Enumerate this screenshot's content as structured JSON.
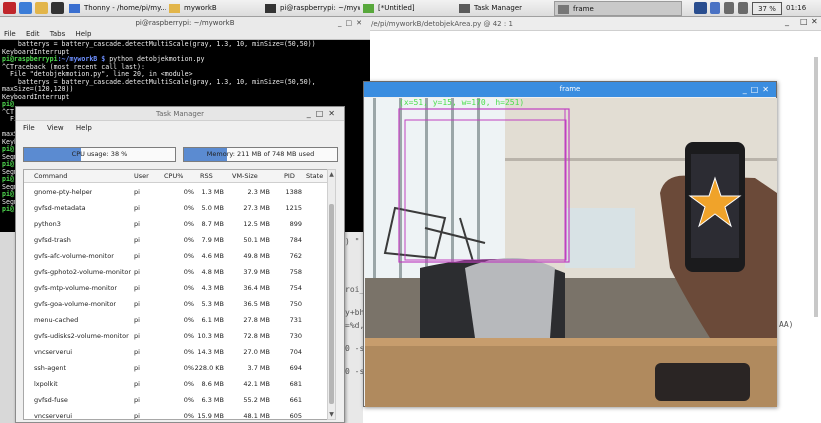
{
  "panel": {
    "tasks": [
      {
        "label": "Thonny - /home/pi/my..."
      },
      {
        "label": "myworkB"
      },
      {
        "label": "pi@raspberrypi: ~/mywo..."
      },
      {
        "label": "[*Untitled]"
      },
      {
        "label": "Task Manager"
      },
      {
        "label": "frame"
      }
    ],
    "battery": "37 %",
    "clock": "01:16"
  },
  "terminal": {
    "title": "pi@raspberrypi: ~/myworkB",
    "menu": [
      "File",
      "Edit",
      "Tabs",
      "Help"
    ],
    "lines": [
      {
        "t": "    batterys = battery_cascade.detectMultiScale(gray, 1.3, 10, minSize=(50,50))",
        "c": ""
      },
      {
        "t": "KeyboardInterrupt",
        "c": ""
      },
      {
        "p": "pi@raspberrypi",
        "d": ":~/myworkB $",
        "t": " python detobjekmotion.py"
      },
      {
        "t": "^CTraceback (most recent call last):",
        "c": ""
      },
      {
        "t": "  File \"detobjekmotion.py\", line 20, in <module>",
        "c": ""
      },
      {
        "t": "    batterys = battery_cascade.detectMultiScale(gray, 1.3, 10, minSize=(50,50),",
        "c": ""
      },
      {
        "t": "maxSize=(120,120))",
        "c": ""
      },
      {
        "t": "KeyboardInterrupt",
        "c": ""
      },
      {
        "p": "pi@",
        "d": "",
        "t": ""
      },
      {
        "t": "^CTr",
        "c": ""
      },
      {
        "t": "  Fi",
        "c": ""
      },
      {
        "t": "                                                                       0),",
        "c": ""
      },
      {
        "t": "maxS",
        "c": ""
      },
      {
        "t": "Keyb",
        "c": ""
      },
      {
        "p": "pi@",
        "d": "",
        "t": ""
      },
      {
        "t": "Segm",
        "c": ""
      },
      {
        "p": "pi@",
        "d": "",
        "t": ""
      },
      {
        "t": "Segm",
        "c": ""
      },
      {
        "p": "pi@",
        "d": "",
        "t": ""
      },
      {
        "t": "Segm",
        "c": ""
      },
      {
        "p": "pi@",
        "d": "",
        "t": ""
      },
      {
        "t": "Segm",
        "c": ""
      },
      {
        "p": "pi@",
        "d": "",
        "t": ""
      }
    ]
  },
  "editor": {
    "tab": "/e/pi/myworkB/detobjekArea.py  @  42 : 1",
    "fragments": [
      ") \" %",
      "roi_",
      "y+bh",
      "=%d,",
      "0 -s",
      "0 -s",
      "AA)"
    ]
  },
  "taskmanager": {
    "title": "Task Manager",
    "menu": [
      "File",
      "View",
      "Help"
    ],
    "cpu_label": "CPU usage: 38 %",
    "cpu_fraction": 0.38,
    "mem_label": "Memory: 211 MB of 748 MB used",
    "mem_fraction": 0.282,
    "columns": [
      "Command",
      "User",
      "CPU%",
      "RSS",
      "VM-Size",
      "PID",
      "State"
    ],
    "rows": [
      [
        "gnome-pty-helper",
        "pi",
        "0%",
        "1.3 MB",
        "2.3 MB",
        "1388"
      ],
      [
        "gvfsd-metadata",
        "pi",
        "0%",
        "5.0 MB",
        "27.3 MB",
        "1215"
      ],
      [
        "python3",
        "pi",
        "0%",
        "8.7 MB",
        "12.5 MB",
        "899"
      ],
      [
        "gvfsd-trash",
        "pi",
        "0%",
        "7.9 MB",
        "50.1 MB",
        "784"
      ],
      [
        "gvfs-afc-volume-monitor",
        "pi",
        "0%",
        "4.6 MB",
        "49.8 MB",
        "762"
      ],
      [
        "gvfs-gphoto2-volume-monitor",
        "pi",
        "0%",
        "4.8 MB",
        "37.9 MB",
        "758"
      ],
      [
        "gvfs-mtp-volume-monitor",
        "pi",
        "0%",
        "4.3 MB",
        "36.4 MB",
        "754"
      ],
      [
        "gvfs-goa-volume-monitor",
        "pi",
        "0%",
        "5.3 MB",
        "36.5 MB",
        "750"
      ],
      [
        "menu-cached",
        "pi",
        "0%",
        "6.1 MB",
        "27.8 MB",
        "731"
      ],
      [
        "gvfs-udisks2-volume-monitor",
        "pi",
        "0%",
        "10.3 MB",
        "72.8 MB",
        "730"
      ],
      [
        "vncserverui",
        "pi",
        "0%",
        "14.3 MB",
        "27.0 MB",
        "704"
      ],
      [
        "ssh-agent",
        "pi",
        "0%",
        "228.0 KB",
        "3.7 MB",
        "694"
      ],
      [
        "lxpolkit",
        "pi",
        "0%",
        "8.6 MB",
        "42.1 MB",
        "681"
      ],
      [
        "gvfsd-fuse",
        "pi",
        "0%",
        "6.3 MB",
        "55.2 MB",
        "661"
      ],
      [
        "vncserverui",
        "pi",
        "0%",
        "15.9 MB",
        "48.1 MB",
        "605"
      ]
    ]
  },
  "frame": {
    "title": "frame",
    "overlay": "(x=51, y=15, w=170, h=251)",
    "colors": {
      "overlay": "#4cde4c",
      "box": "#c040c0"
    }
  }
}
